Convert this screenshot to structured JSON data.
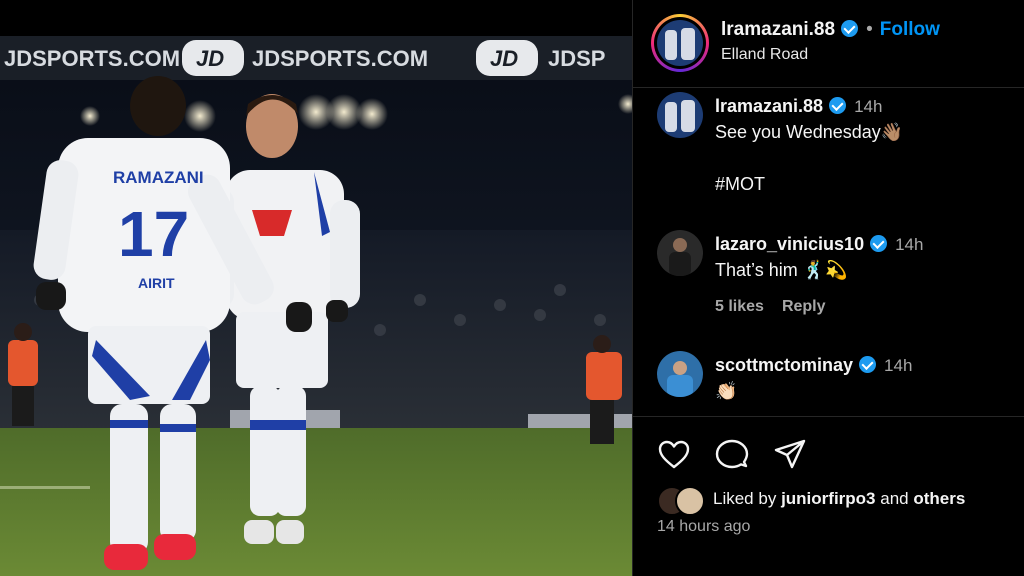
{
  "photo": {
    "banner_texts": [
      "JDSPORTS.COM",
      "JDSPORTS.COM",
      "JDSP"
    ],
    "banner_logo": "JD",
    "player1": {
      "name": "RAMAZANI",
      "number": "17",
      "sponsor": "AIRIT"
    }
  },
  "header": {
    "username": "lramazani.88",
    "separator": "•",
    "follow_label": "Follow",
    "location": "Elland Road"
  },
  "comments": [
    {
      "username": "lramazani.88",
      "time": "14h",
      "text": "See you Wednesday👋🏽\n\n#MOT"
    },
    {
      "username": "lazaro_vinicius10",
      "time": "14h",
      "text": "That’s him 🕺💫",
      "likes": "5 likes",
      "reply": "Reply"
    },
    {
      "username": "scottmctominay",
      "time": "14h",
      "text": "👏🏻"
    }
  ],
  "actions": {
    "icons": [
      "heart-icon",
      "comment-icon",
      "share-icon"
    ]
  },
  "likes": {
    "prefix": "Liked by",
    "user": "juniorfirpo3",
    "middle": "and",
    "others": "others"
  },
  "timestamp": "14 hours ago",
  "colors": {
    "accent": "#0095f6",
    "verified": "#1d9bf0",
    "kit_blue": "#1f3fa6",
    "pitch": "#5e7d2e"
  }
}
